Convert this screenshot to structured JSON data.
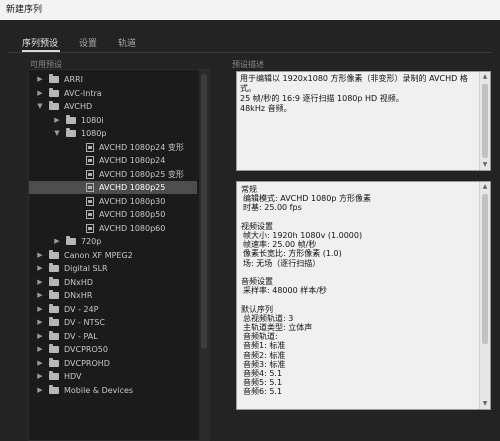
{
  "window": {
    "title": "新建序列"
  },
  "tabs": [
    {
      "label": "序列预设",
      "active": true
    },
    {
      "label": "设置",
      "active": false
    },
    {
      "label": "轨道",
      "active": false
    }
  ],
  "left_panel": {
    "label": "可用预设"
  },
  "right_panel": {
    "label": "预设描述"
  },
  "tree": [
    {
      "label": "ARRI",
      "type": "folder",
      "level": 0,
      "expanded": false,
      "selected": false
    },
    {
      "label": "AVC-Intra",
      "type": "folder",
      "level": 0,
      "expanded": false,
      "selected": false
    },
    {
      "label": "AVCHD",
      "type": "folder",
      "level": 0,
      "expanded": true,
      "selected": false
    },
    {
      "label": "1080i",
      "type": "folder",
      "level": 1,
      "expanded": false,
      "selected": false
    },
    {
      "label": "1080p",
      "type": "folder",
      "level": 1,
      "expanded": true,
      "selected": false
    },
    {
      "label": "AVCHD 1080p24 变形",
      "type": "preset",
      "level": 2,
      "selected": false
    },
    {
      "label": "AVCHD 1080p24",
      "type": "preset",
      "level": 2,
      "selected": false
    },
    {
      "label": "AVCHD 1080p25 变形",
      "type": "preset",
      "level": 2,
      "selected": false
    },
    {
      "label": "AVCHD 1080p25",
      "type": "preset",
      "level": 2,
      "selected": true
    },
    {
      "label": "AVCHD 1080p30",
      "type": "preset",
      "level": 2,
      "selected": false
    },
    {
      "label": "AVCHD 1080p50",
      "type": "preset",
      "level": 2,
      "selected": false
    },
    {
      "label": "AVCHD 1080p60",
      "type": "preset",
      "level": 2,
      "selected": false
    },
    {
      "label": "720p",
      "type": "folder",
      "level": 1,
      "expanded": false,
      "selected": false
    },
    {
      "label": "Canon XF MPEG2",
      "type": "folder",
      "level": 0,
      "expanded": false,
      "selected": false
    },
    {
      "label": "Digital SLR",
      "type": "folder",
      "level": 0,
      "expanded": false,
      "selected": false
    },
    {
      "label": "DNxHD",
      "type": "folder",
      "level": 0,
      "expanded": false,
      "selected": false
    },
    {
      "label": "DNxHR",
      "type": "folder",
      "level": 0,
      "expanded": false,
      "selected": false
    },
    {
      "label": "DV - 24P",
      "type": "folder",
      "level": 0,
      "expanded": false,
      "selected": false
    },
    {
      "label": "DV - NTSC",
      "type": "folder",
      "level": 0,
      "expanded": false,
      "selected": false
    },
    {
      "label": "DV - PAL",
      "type": "folder",
      "level": 0,
      "expanded": false,
      "selected": false
    },
    {
      "label": "DVCPRO50",
      "type": "folder",
      "level": 0,
      "expanded": false,
      "selected": false
    },
    {
      "label": "DVCPROHD",
      "type": "folder",
      "level": 0,
      "expanded": false,
      "selected": false
    },
    {
      "label": "HDV",
      "type": "folder",
      "level": 0,
      "expanded": false,
      "selected": false
    },
    {
      "label": "Mobile & Devices",
      "type": "folder",
      "level": 0,
      "expanded": false,
      "selected": false
    }
  ],
  "description": {
    "text": "用于编辑以 1920x1080 方形像素（非变形）录制的 AVCHD 格式。\n25 帧/秒的 16:9 逐行扫描 1080p HD 视频。\n48kHz 音频。"
  },
  "details": {
    "lines": [
      {
        "text": "常规",
        "indent": false
      },
      {
        "text": "编辑模式: AVCHD 1080p 方形像素",
        "indent": true
      },
      {
        "text": "时基: 25.00 fps",
        "indent": true
      },
      {
        "text": "",
        "indent": false
      },
      {
        "text": "视频设置",
        "indent": false
      },
      {
        "text": "帧大小: 1920h 1080v (1.0000)",
        "indent": true
      },
      {
        "text": "帧速率: 25.00 帧/秒",
        "indent": true
      },
      {
        "text": "像素长宽比: 方形像素 (1.0)",
        "indent": true
      },
      {
        "text": "场: 无场（逐行扫描）",
        "indent": true
      },
      {
        "text": "",
        "indent": false
      },
      {
        "text": "音频设置",
        "indent": false
      },
      {
        "text": "采样率: 48000 样本/秒",
        "indent": true
      },
      {
        "text": "",
        "indent": false
      },
      {
        "text": "默认序列",
        "indent": false
      },
      {
        "text": "总视频轨道: 3",
        "indent": true
      },
      {
        "text": "主轨道类型: 立体声",
        "indent": true
      },
      {
        "text": "音频轨道:",
        "indent": true
      },
      {
        "text": "音频1: 标准",
        "indent": true
      },
      {
        "text": "音频2: 标准",
        "indent": true
      },
      {
        "text": "音频3: 标准",
        "indent": true
      },
      {
        "text": "音频4: 5.1",
        "indent": true
      },
      {
        "text": "音频5: 5.1",
        "indent": true
      },
      {
        "text": "音频6: 5.1",
        "indent": true
      }
    ]
  },
  "colors": {
    "background": "#232323",
    "tree_background": "#1b1b1b",
    "selected_row": "#4d4d4d",
    "info_box_background": "#f0f0f0",
    "title_bar": "#f3f3f3"
  }
}
